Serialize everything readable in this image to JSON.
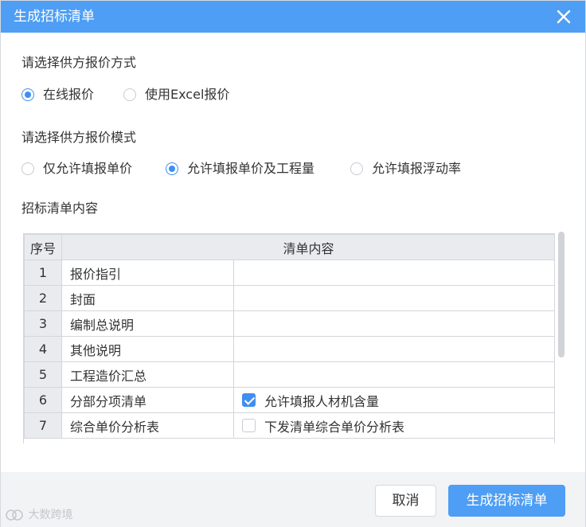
{
  "dialog": {
    "title": "生成招标清单"
  },
  "quote_method": {
    "label": "请选择供方报价方式",
    "options": [
      {
        "label": "在线报价",
        "checked": true
      },
      {
        "label": "使用Excel报价",
        "checked": false
      }
    ]
  },
  "quote_mode": {
    "label": "请选择供方报价模式",
    "options": [
      {
        "label": "仅允许填报单价",
        "checked": false
      },
      {
        "label": "允许填报单价及工程量",
        "checked": true
      },
      {
        "label": "允许填报浮动率",
        "checked": false
      }
    ]
  },
  "list_content": {
    "label": "招标清单内容",
    "columns": [
      "序号",
      "清单内容"
    ],
    "rows": [
      {
        "index": "1",
        "name": "报价指引",
        "option": "",
        "option_checked": null
      },
      {
        "index": "2",
        "name": "封面",
        "option": "",
        "option_checked": null
      },
      {
        "index": "3",
        "name": "编制总说明",
        "option": "",
        "option_checked": null
      },
      {
        "index": "4",
        "name": "其他说明",
        "option": "",
        "option_checked": null
      },
      {
        "index": "5",
        "name": "工程造价汇总",
        "option": "",
        "option_checked": null
      },
      {
        "index": "6",
        "name": "分部分项清单",
        "option": "允许填报人材机含量",
        "option_checked": true
      },
      {
        "index": "7",
        "name": "综合单价分析表",
        "option": "下发清单综合单价分析表",
        "option_checked": false
      }
    ]
  },
  "footer": {
    "cancel_label": "取消",
    "confirm_label": "生成招标清单"
  },
  "watermark": {
    "text": "大数跨境"
  },
  "colors": {
    "accent": "#4d9ef4",
    "checked": "#3f8ff1",
    "header_bg": "#e9ebee",
    "footer_bg": "#f2f3f5"
  }
}
